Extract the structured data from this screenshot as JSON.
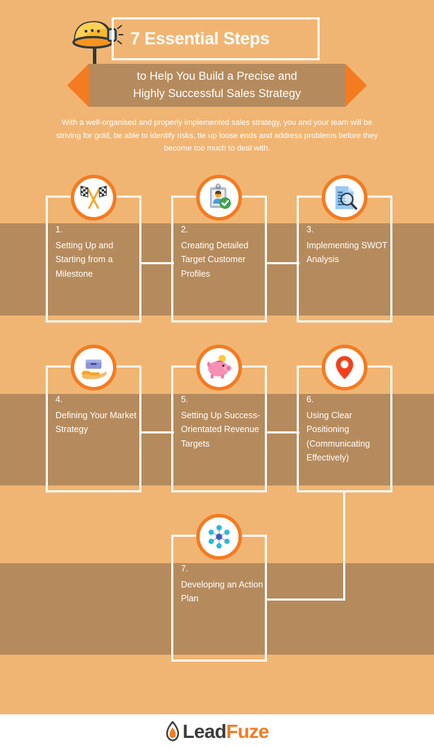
{
  "header": {
    "title_main": "7 Essential Steps",
    "ribbon_line_1": "to Help You Build a Precise and",
    "ribbon_line_2": "Highly Successful Sales Strategy",
    "intro": "With a well-organised and properly implemented sales strategy, you and your team will be striving for gold, be able to identify risks, tie up loose ends and address problems before they become too much to deal with.",
    "helmet_icon": "mining-helmet-icon"
  },
  "steps": [
    {
      "number": "1.",
      "title": "Setting Up and Starting from a Milestone",
      "icon": "racing-flags-icon"
    },
    {
      "number": "2.",
      "title": "Creating Detailed Target Customer Profiles",
      "icon": "customer-profile-check-icon"
    },
    {
      "number": "3.",
      "title": "Implementing SWOT Analysis",
      "icon": "document-magnifier-icon"
    },
    {
      "number": "4.",
      "title": "Defining Your Market Strategy",
      "icon": "hand-holding-box-icon"
    },
    {
      "number": "5.",
      "title": "Setting Up Success-Orientated Revenue Targets",
      "icon": "piggy-bank-icon"
    },
    {
      "number": "6.",
      "title": "Using Clear Positioning (Communicating Effectively)",
      "icon": "map-pin-icon"
    },
    {
      "number": "7.",
      "title": "Developing an Action Plan",
      "icon": "network-nodes-icon"
    }
  ],
  "footer": {
    "logo_part_1": "Lead",
    "logo_part_2": "Fuze",
    "logo_icon": "flame-icon"
  },
  "colors": {
    "background": "#F1B573",
    "band": "#B58B5D",
    "accent_orange": "#F47B20",
    "white": "#FFFFFF",
    "logo_dark": "#3C3C3C"
  }
}
